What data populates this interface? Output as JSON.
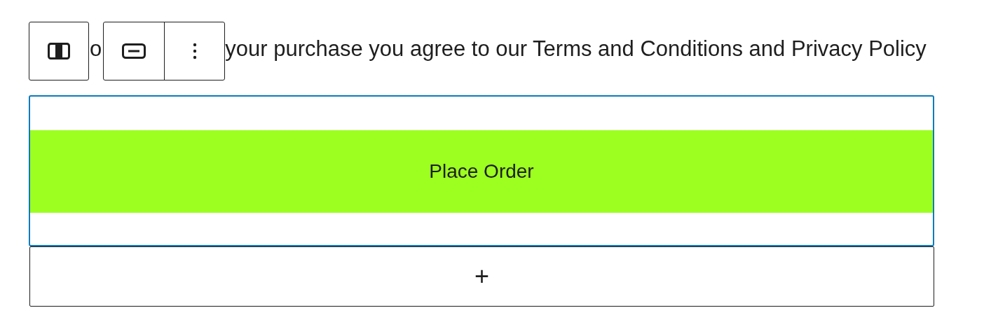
{
  "notice": {
    "fragments": [
      "o",
      "your purchase you agree to our Terms and Conditions and Privacy Policy"
    ]
  },
  "toolbar": {
    "buttons": [
      {
        "kind": "width"
      },
      {
        "kind": "align"
      },
      {
        "kind": "more"
      }
    ]
  },
  "order_button": {
    "label": "Place Order",
    "color": "#9dff20",
    "selected": true
  },
  "appender": {
    "label": "+"
  }
}
